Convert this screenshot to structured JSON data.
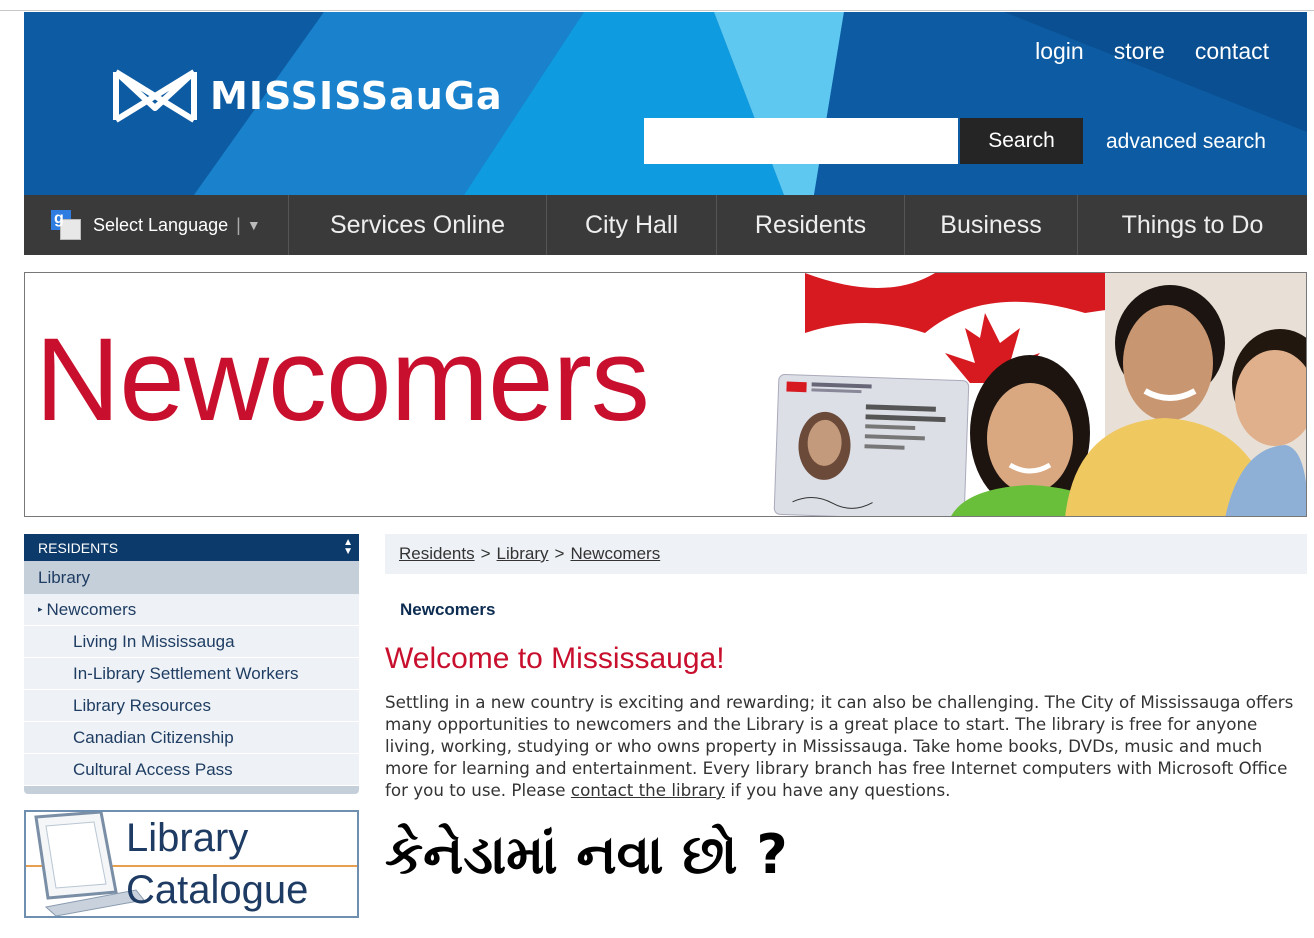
{
  "header": {
    "logo_text": "MISSISSauGa",
    "top_links": [
      "login",
      "store",
      "contact"
    ],
    "search": {
      "placeholder": "",
      "button_label": "Search"
    },
    "advanced_search": "advanced search"
  },
  "nav": {
    "language_label": "Select Language",
    "language_separator": "|",
    "language_arrow": "▼",
    "items": [
      "Services Online",
      "City Hall",
      "Residents",
      "Business",
      "Things to Do"
    ]
  },
  "banner": {
    "title": "Newcomers"
  },
  "sidebar": {
    "section_title": "RESIDENTS",
    "parent": "Library",
    "current": "Newcomers",
    "current_marker": "▸",
    "children": [
      "Living In Mississauga",
      "In-Library Settlement Workers",
      "Library Resources",
      "Canadian Citizenship",
      "Cultural Access Pass"
    ],
    "catalogue": {
      "line1": "Library",
      "line2": "Catalogue"
    }
  },
  "breadcrumb": {
    "items": [
      "Residents",
      "Library",
      "Newcomers"
    ],
    "separator": ">"
  },
  "content": {
    "subtitle": "Newcomers",
    "heading": "Welcome to Mississauga!",
    "paragraph_start": "Settling in a new country is exciting and rewarding; it can also be challenging. The City of Mississauga offers many opportunities to newcomers and the Library is a great place to start. The library is free for anyone living, working, studying or who owns property in Mississauga. Take home books, DVDs, music and much more for learning and entertainment. Every library branch has free Internet computers with Microsoft Office for you to use. Please ",
    "paragraph_link": "contact the library",
    "paragraph_end": " if you have any questions.",
    "gujarati_heading": "કેનેડામાં નવા છો ?"
  },
  "colors": {
    "header_blue": "#1470b8",
    "nav_dark": "#3a3a3a",
    "accent_red": "#c8102e",
    "sidebar_navy": "#0c3a6a"
  }
}
